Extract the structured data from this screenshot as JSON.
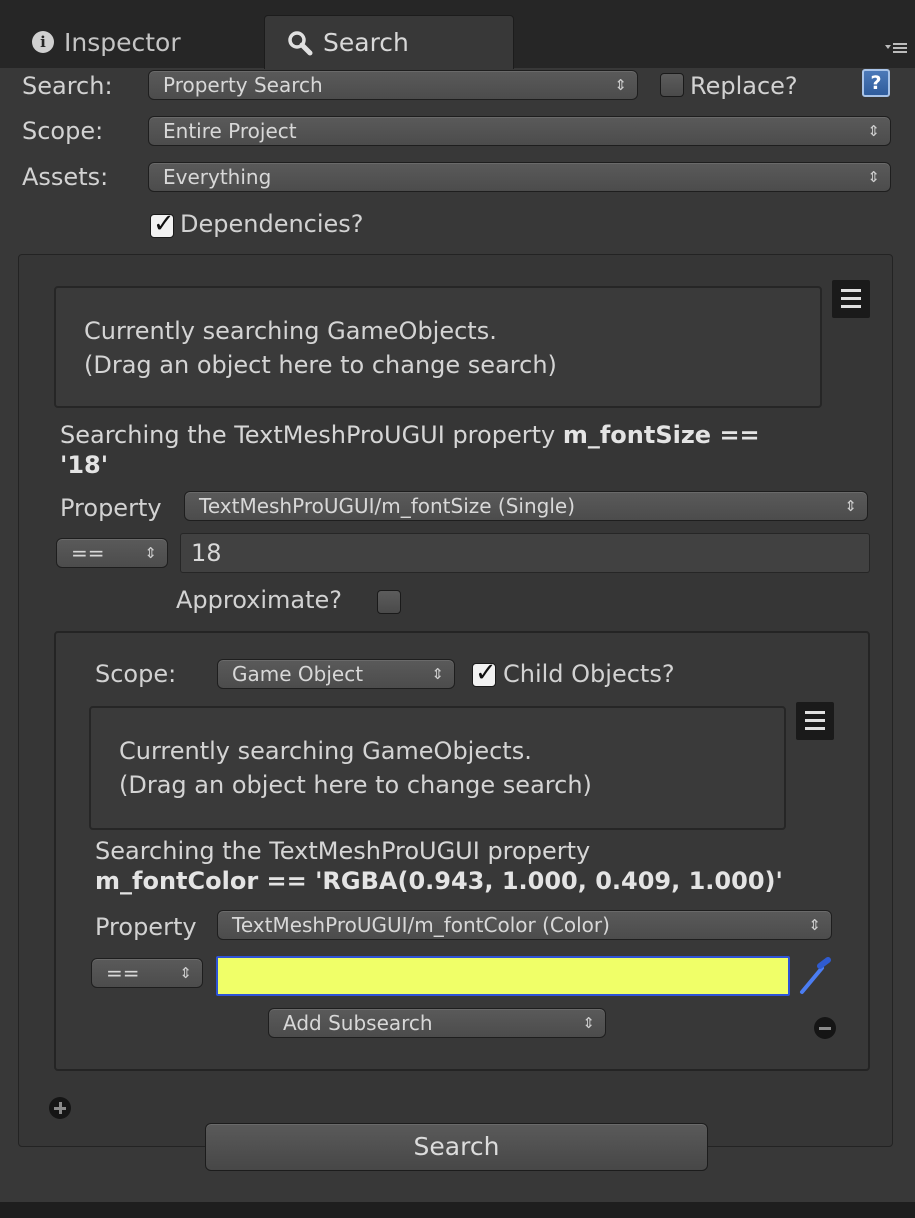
{
  "tabs": {
    "inspector": "Inspector",
    "search": "Search"
  },
  "header": {
    "search_label": "Search:",
    "search_mode": "Property Search",
    "replace_label": "Replace?",
    "help_glyph": "?",
    "scope_label": "Scope:",
    "scope_value": "Entire Project",
    "assets_label": "Assets:",
    "assets_value": "Everything",
    "dependencies_label": "Dependencies?",
    "dependencies_checked": true,
    "replace_checked": false
  },
  "outer_search": {
    "drop_line1": "Currently searching GameObjects.",
    "drop_line2": "(Drag an object here to change search)",
    "desc_prefix": "Searching the TextMeshProUGUI property ",
    "desc_bold_line1": "m_fontSize ==",
    "desc_bold_line2": "'18'",
    "property_label": "Property",
    "property_value": "TextMeshProUGUI/m_fontSize (Single)",
    "operator": "==",
    "value": "18",
    "approximate_label": "Approximate?",
    "approximate_checked": false
  },
  "subsearch": {
    "scope_label": "Scope:",
    "scope_value": "Game Object",
    "child_objects_label": "Child Objects?",
    "child_objects_checked": true,
    "drop_line1": "Currently searching GameObjects.",
    "drop_line2": "(Drag an object here to change search)",
    "desc_line1": "Searching the TextMeshProUGUI property",
    "desc_bold": "m_fontColor == 'RGBA(0.943, 1.000, 0.409, 1.000)'",
    "property_label": "Property",
    "property_value": "TextMeshProUGUI/m_fontColor (Color)",
    "operator": "==",
    "color_value": "#f0ff68",
    "add_subsearch": "Add Subsearch"
  },
  "footer": {
    "search_button": "Search"
  },
  "icons": [
    "info-icon",
    "magnifier-icon",
    "tab-menu-icon",
    "help-icon",
    "hamburger-menu-icon",
    "eyedropper-icon",
    "remove-icon",
    "add-icon"
  ]
}
